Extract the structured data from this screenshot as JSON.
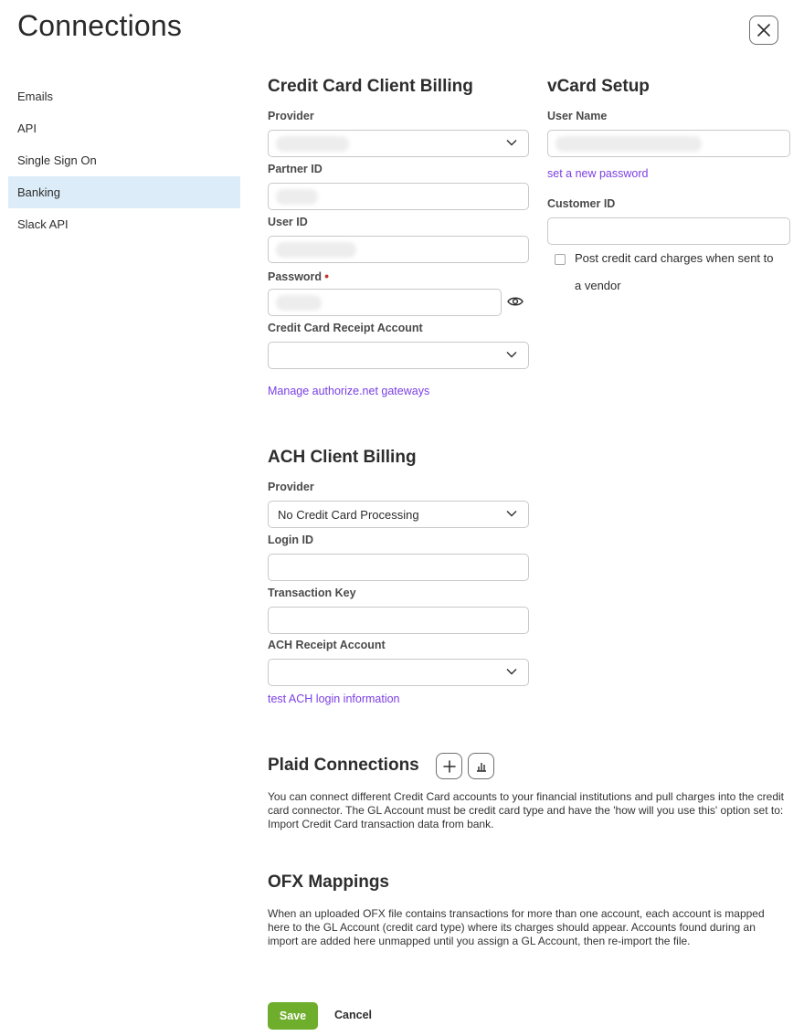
{
  "header": {
    "title": "Connections"
  },
  "sidebar": {
    "items": [
      {
        "label": "Emails"
      },
      {
        "label": "API"
      },
      {
        "label": "Single Sign On"
      },
      {
        "label": "Banking"
      },
      {
        "label": "Slack API"
      }
    ],
    "active": "Banking"
  },
  "credit_card": {
    "title": "Credit Card Client Billing",
    "provider_label": "Provider",
    "partner_id_label": "Partner ID",
    "user_id_label": "User ID",
    "password_label": "Password",
    "receipt_account_label": "Credit Card Receipt Account",
    "manage_link": "Manage authorize.net gateways"
  },
  "vcard": {
    "title": "vCard Setup",
    "user_name_label": "User Name",
    "new_password_link": "set a new password",
    "customer_id_label": "Customer ID",
    "post_charges_label_line1": "Post credit card charges when sent to",
    "post_charges_label_line2": "a vendor"
  },
  "ach": {
    "title": "ACH Client Billing",
    "provider_label": "Provider",
    "provider_value": "No Credit Card Processing",
    "login_id_label": "Login ID",
    "transaction_key_label": "Transaction Key",
    "receipt_account_label": "ACH Receipt Account",
    "test_link": "test ACH login information"
  },
  "plaid": {
    "title": "Plaid Connections",
    "description": "You can connect different Credit Card accounts to your financial institutions and pull charges into the credit card connector. The GL Account must be credit card type and have the 'how will you use this' option set to: Import Credit Card transaction data from bank."
  },
  "ofx": {
    "title": "OFX Mappings",
    "description": "When an uploaded OFX file contains transactions for more than one account, each account is mapped here to the GL Account (credit card type) where its charges should appear. Accounts found during an import are added here unmapped until you assign a GL Account, then re-import the file."
  },
  "footer": {
    "save_label": "Save",
    "cancel_label": "Cancel"
  },
  "colors": {
    "accent_link": "#7b3fe4",
    "save_green": "#6fae2c",
    "active_nav": "#dcecf8",
    "required": "#c0392b"
  }
}
